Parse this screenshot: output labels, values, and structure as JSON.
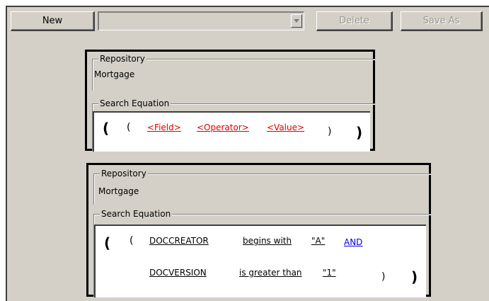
{
  "toolbar": {
    "new_label": "New",
    "query_select_value": "",
    "delete_label": "Delete",
    "save_as_label": "Save As"
  },
  "panel1": {
    "repository_legend": "Repository",
    "repository_value": "Mortgage",
    "equation_legend": "Search Equation",
    "open_outer": "(",
    "open_inner": "(",
    "field": "<Field>",
    "operator": "<Operator>",
    "value": "<Value>",
    "close_inner": ")",
    "close_outer": ")"
  },
  "panel2": {
    "repository_legend": "Repository",
    "repository_value": "Mortgage",
    "equation_legend": "Search Equation",
    "open_outer": "(",
    "open_inner": "(",
    "cond1_field": "DOCCREATOR",
    "cond1_operator": "begins with",
    "cond1_value": "\"A\"",
    "logic_operator": "AND",
    "cond2_field": "DOCVERSION",
    "cond2_operator": "is greater than",
    "cond2_value": "\"1\"",
    "close_inner": ")",
    "close_outer": ")"
  },
  "colors": {
    "placeholder": "#e00000",
    "logic_operator": "#0000e0",
    "dialog_background": "#d4d0c8"
  }
}
